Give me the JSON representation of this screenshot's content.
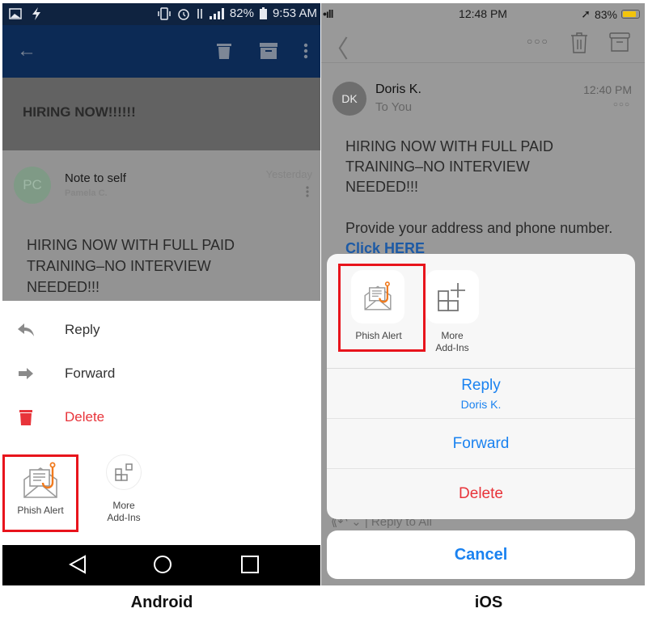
{
  "android": {
    "status_bar": {
      "time": "9:53 AM",
      "battery": "82%",
      "left_icons": [
        "image-icon",
        "flash-icon"
      ],
      "right_icons": [
        "vibrate-icon",
        "alarm-icon",
        "data-icon",
        "signal-icon",
        "battery-icon"
      ]
    },
    "toolbar": {
      "back_icon": "arrow-left-icon",
      "actions": [
        "trash-icon",
        "archive-icon",
        "more-vert-icon"
      ]
    },
    "subject": "HIRING NOW!!!!!!",
    "message": {
      "avatar_initials": "PC",
      "title": "Note to self",
      "sender": "Pamela C.",
      "date": "Yesterday",
      "body_lines": [
        "HIRING NOW WITH FULL PAID",
        "TRAINING–NO INTERVIEW",
        "NEEDED!!!"
      ]
    },
    "sheet": {
      "items": [
        {
          "label": "Reply",
          "icon": "reply-icon"
        },
        {
          "label": "Forward",
          "icon": "forward-icon"
        },
        {
          "label": "Delete",
          "icon": "trash-icon"
        }
      ],
      "addins": [
        {
          "label": "Phish Alert",
          "icon": "phish-alert-icon",
          "highlighted": true
        },
        {
          "label": "More\nAdd-Ins",
          "label_lines": [
            "More",
            "Add-Ins"
          ],
          "icon": "add-ins-icon"
        }
      ]
    },
    "nav": [
      "back-triangle-icon",
      "home-circle-icon",
      "recents-square-icon"
    ],
    "caption": "Android"
  },
  "ios": {
    "status_bar": {
      "time": "12:48 PM",
      "battery": "83%",
      "battery_level": 0.83,
      "signal": "•ıll",
      "location_icon": "location-arrow-icon"
    },
    "toolbar": {
      "back_icon": "chevron-left-icon",
      "actions": [
        "more-horiz-icon",
        "trash-icon",
        "archive-icon"
      ]
    },
    "message": {
      "avatar_initials": "DK",
      "from": "Doris K.",
      "to": "To You",
      "time": "12:40 PM",
      "body_lines": [
        "HIRING NOW WITH FULL PAID",
        "TRAINING–NO INTERVIEW",
        "NEEDED!!!"
      ],
      "body2_text": "Provide your address and phone number.",
      "link_text": "Click HERE"
    },
    "sheet": {
      "addins": [
        {
          "label": "Phish Alert",
          "icon": "phish-alert-icon",
          "highlighted": true
        },
        {
          "label_lines": [
            "More",
            "Add-Ins"
          ],
          "icon": "add-ins-icon"
        }
      ],
      "actions": [
        {
          "label": "Reply",
          "sub": "Doris K."
        },
        {
          "label": "Forward"
        },
        {
          "label": "Delete"
        }
      ],
      "cancel": "Cancel"
    },
    "reply_all": "Reply to All",
    "caption": "iOS"
  },
  "colors": {
    "highlight": "#e8141c",
    "ios_blue": "#1a82f0",
    "delete_red": "#e8343a",
    "android_toolbar": "#0c2a55",
    "phish_orange": "#f07a1e"
  }
}
